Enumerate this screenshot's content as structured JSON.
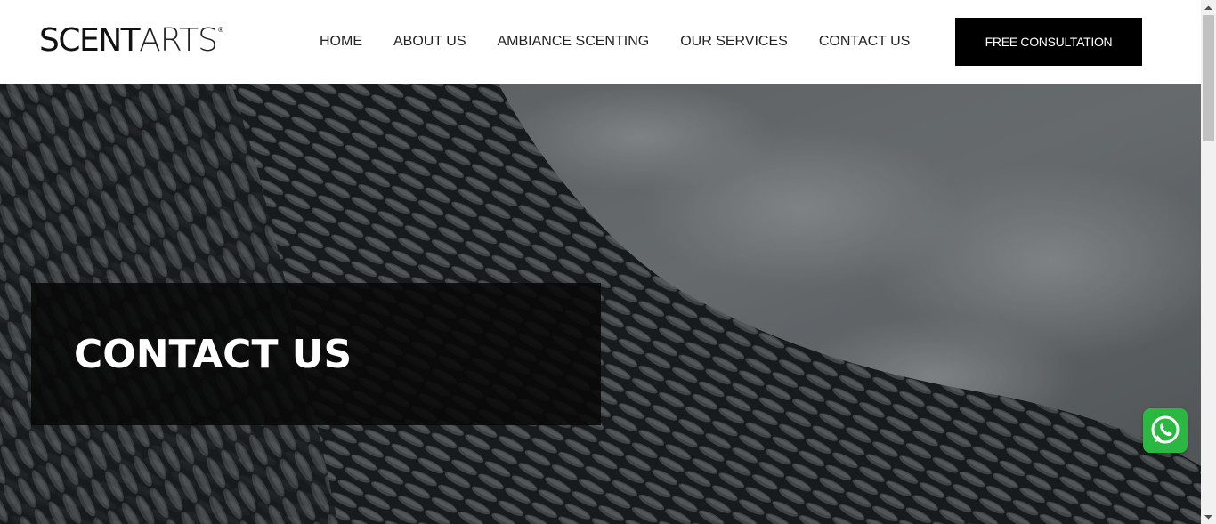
{
  "header": {
    "logo": {
      "part1": "SCENT",
      "part2": "ARTS",
      "mark": "®"
    },
    "nav": [
      {
        "label": "HOME"
      },
      {
        "label": "ABOUT US"
      },
      {
        "label": "AMBIANCE SCENTING"
      },
      {
        "label": "OUR SERVICES"
      },
      {
        "label": "CONTACT US"
      }
    ],
    "cta_label": "FREE CONSULTATION"
  },
  "hero": {
    "title": "CONTACT US"
  },
  "icons": {
    "whatsapp": "whatsapp-icon",
    "scroll_up": "arrow-up-icon",
    "scroll_down": "arrow-down-icon"
  },
  "colors": {
    "header_bg": "#ffffff",
    "cta_bg": "#000000",
    "whatsapp": "#2bb741",
    "title_box": "#080808"
  }
}
